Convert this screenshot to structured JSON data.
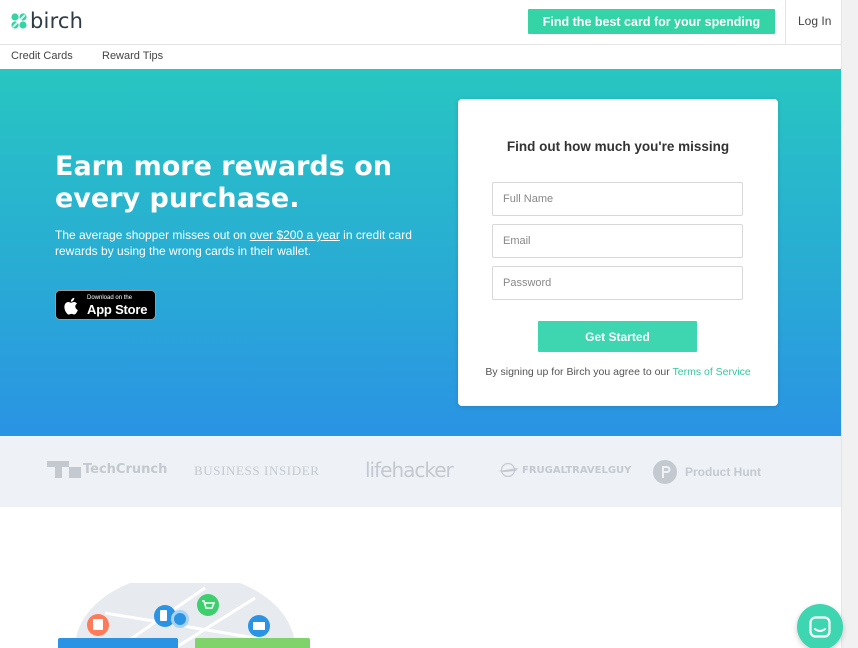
{
  "brand": {
    "name": "birch",
    "accent": "#34d4a6",
    "hero_gradient": [
      "#27c6c1",
      "#2a93e4"
    ]
  },
  "header": {
    "cta_label": "Find the best card for your spending",
    "login_label": "Log In"
  },
  "subnav": {
    "items": [
      "Credit Cards",
      "Reward Tips"
    ]
  },
  "hero": {
    "title": "Earn more rewards on every purchase.",
    "desc_before": "The average shopper misses out on ",
    "desc_link": "over $200 a year",
    "desc_after": " in credit card rewards by using the wrong cards in their wallet.",
    "appstore_small": "Download on the",
    "appstore_big": "App Store"
  },
  "signup": {
    "title": "Find out how much you're missing",
    "full_name_placeholder": "Full Name",
    "email_placeholder": "Email",
    "password_placeholder": "Password",
    "submit_label": "Get Started",
    "terms_prefix": "By signing up for Birch you agree to our ",
    "terms_link": "Terms of Service"
  },
  "press": {
    "techcrunch": "TechCrunch",
    "business_insider": "BUSINESS INSIDER",
    "lifehacker": "lifehacker",
    "frugal": "FRUGALTRAVELGUY",
    "producthunt": "Product Hunt"
  }
}
